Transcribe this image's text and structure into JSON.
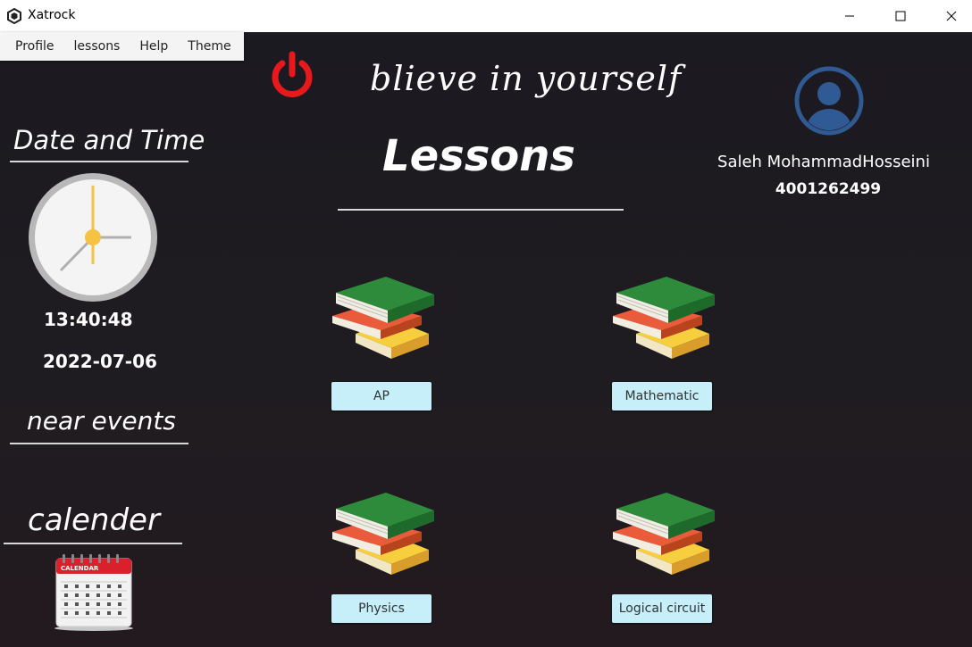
{
  "window": {
    "title": "Xatrock"
  },
  "menu": {
    "items": [
      "Profile",
      "lessons",
      "Help",
      "Theme"
    ]
  },
  "header": {
    "motto": "blieve in yourself",
    "heading": "Lessons"
  },
  "sidebar": {
    "date_time_title": "Date and Time",
    "time": "13:40:48",
    "date": "2022-07-06",
    "near_events_title": "near events",
    "calendar_title": "calender",
    "calendar_icon_label": "CALENDAR"
  },
  "user": {
    "name": "Saleh MohammadHosseini",
    "id": "4001262499"
  },
  "lessons": [
    {
      "label": "AP"
    },
    {
      "label": "Mathematic"
    },
    {
      "label": "Physics"
    },
    {
      "label": "Logical circuit"
    }
  ],
  "icons": {
    "power": "power-icon",
    "avatar": "user-avatar-icon",
    "clock": "clock-icon",
    "calendar": "calendar-icon",
    "book": "book-stack-icon"
  },
  "colors": {
    "power": "#e8191c",
    "avatar": "#2f5a94",
    "lesson_button": "#c6eff9",
    "clock_hand": "#f5c242"
  }
}
